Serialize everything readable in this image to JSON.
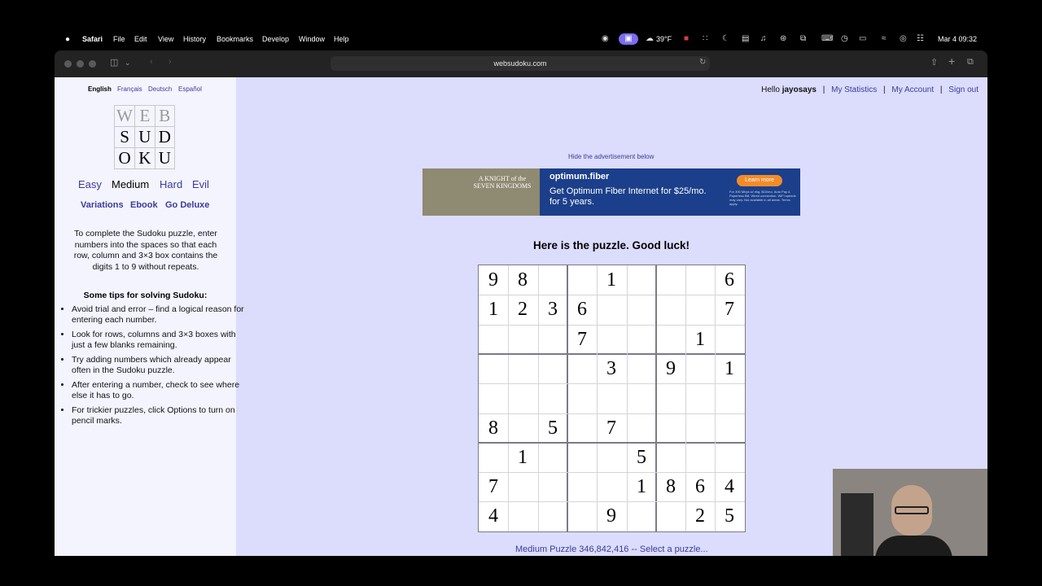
{
  "menubar": {
    "apple": "",
    "app": "Safari",
    "items": [
      "File",
      "Edit",
      "View",
      "History",
      "Bookmarks",
      "Develop",
      "Window",
      "Help"
    ],
    "weather": "39°F",
    "datetime": "Mar 4  09:32"
  },
  "browser": {
    "url": "websudoku.com"
  },
  "sidebar": {
    "languages": [
      "English",
      "Français",
      "Deutsch",
      "Español"
    ],
    "logo": [
      "W",
      "E",
      "B",
      "S",
      "U",
      "D",
      "O",
      "K",
      "U"
    ],
    "difficulties": [
      "Easy",
      "Medium",
      "Hard",
      "Evil"
    ],
    "current_difficulty": "Medium",
    "links": [
      "Variations",
      "Ebook",
      "Go Deluxe"
    ],
    "intro": "To complete the Sudoku puzzle, enter numbers into the spaces so that each row, column and 3×3 box contains the digits 1 to 9 without repeats.",
    "tips_title": "Some tips for solving Sudoku:",
    "tips": [
      "Avoid trial and error – find a logical reason for entering each number.",
      "Look for rows, columns and 3×3 boxes with just a few blanks remaining.",
      "Try adding numbers which already appear often in the Sudoku puzzle.",
      "After entering a number, check to see where else it has to go.",
      "For trickier puzzles, click Options to turn on pencil marks."
    ]
  },
  "user": {
    "hello": "Hello",
    "username": "jayosays",
    "links": [
      "My Statistics",
      "My Account",
      "Sign out"
    ]
  },
  "ad": {
    "hide_text": "Hide the advertisement below",
    "image_text": "A KNIGHT of the SEVEN KINGDOMS",
    "brand": "optimum.fiber",
    "headline": "Get Optimum Fiber Internet for $25/mo. for 5 years.",
    "button": "Learn more",
    "fine_print": "For 300 Mbps w/ elig. $10/mo. Auto Pay & Paperless Bill. Wired connection. WiFi speeds may vary. Not available in all areas. Terms apply."
  },
  "puzzle": {
    "title": "Here is the puzzle. Good luck!",
    "grid": [
      [
        "9",
        "8",
        "",
        "",
        "1",
        "",
        "",
        "",
        "6"
      ],
      [
        "1",
        "2",
        "3",
        "6",
        "",
        "",
        "",
        "",
        "7"
      ],
      [
        "",
        "",
        "",
        "7",
        "",
        "",
        "",
        "1",
        ""
      ],
      [
        "",
        "",
        "",
        "",
        "3",
        "",
        "9",
        "",
        "1"
      ],
      [
        "",
        "",
        "",
        "",
        "",
        "",
        "",
        "",
        ""
      ],
      [
        "8",
        "",
        "5",
        "",
        "7",
        "",
        "",
        "",
        ""
      ],
      [
        "",
        "1",
        "",
        "",
        "",
        "5",
        "",
        "",
        ""
      ],
      [
        "7",
        "",
        "",
        "",
        "",
        "1",
        "8",
        "6",
        "4"
      ],
      [
        "4",
        "",
        "",
        "",
        "9",
        "",
        "",
        "2",
        "5"
      ]
    ],
    "footer": "Medium Puzzle 346,842,416 -- Select a puzzle..."
  }
}
